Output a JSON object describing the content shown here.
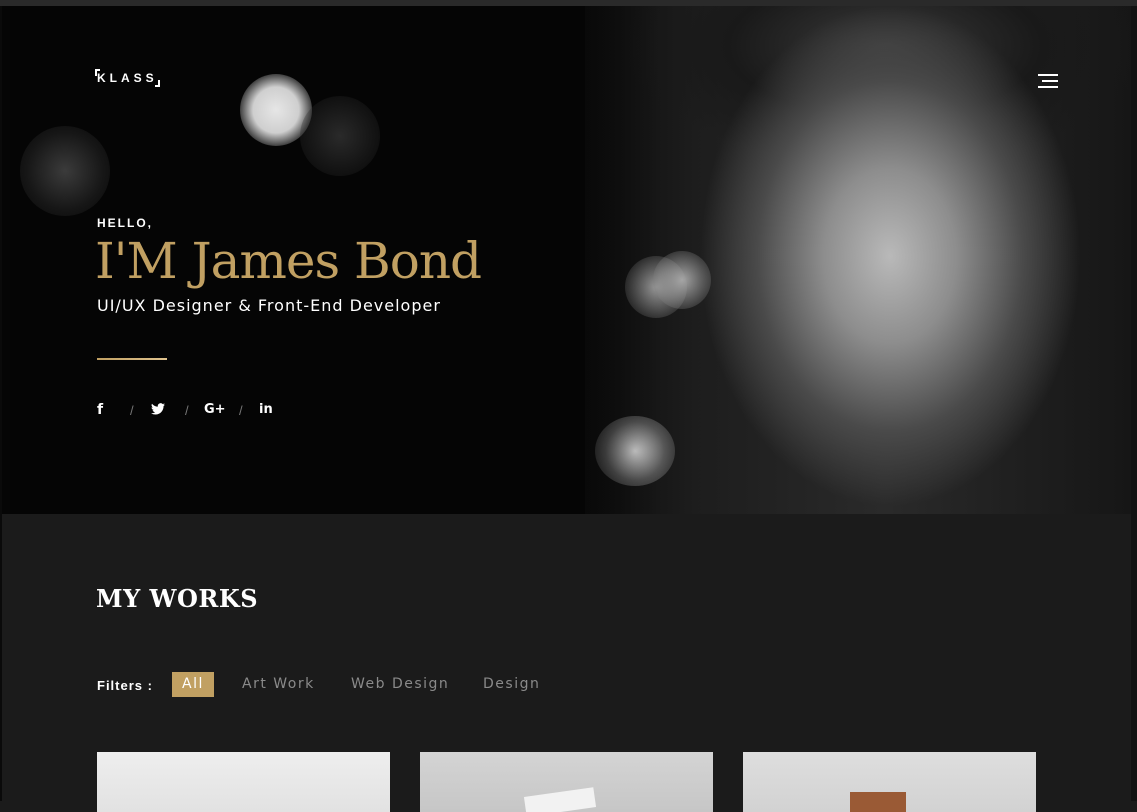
{
  "brand": {
    "logo": "KLASS"
  },
  "hero": {
    "greeting": "HELLO,",
    "name": "I'M James Bond",
    "role": "UI/UX Designer & Front-End Developer",
    "social": [
      {
        "icon": "facebook-icon",
        "glyph": "f"
      },
      {
        "icon": "twitter-icon",
        "glyph": "🐦"
      },
      {
        "icon": "google-plus-icon",
        "glyph": "G+"
      },
      {
        "icon": "linkedin-icon",
        "glyph": "in"
      }
    ],
    "separator": "/"
  },
  "works": {
    "title": "MY WORKS",
    "filters_label": "Filters :",
    "filters": [
      "All",
      "Art Work",
      "Web Design",
      "Design"
    ],
    "active_filter": "All"
  },
  "colors": {
    "accent": "#c1a062",
    "background": "#1b1b1b",
    "hero_bg": "#050505"
  }
}
